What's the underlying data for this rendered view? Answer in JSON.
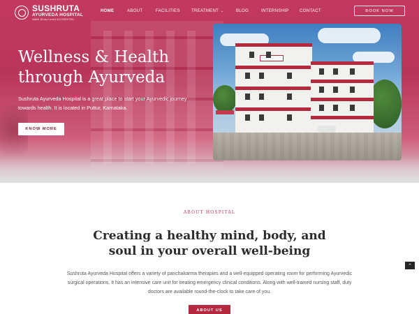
{
  "brand": {
    "name": "SUSHRUTA",
    "subtitle": "AYURVEDA HOSPITAL",
    "tagline": "NABH (Entry Level) ACCREDITED",
    "icon": "lotus-emblem-icon"
  },
  "nav": {
    "items": [
      {
        "label": "HOME",
        "active": true
      },
      {
        "label": "ABOUT",
        "active": false
      },
      {
        "label": "FACILITIES",
        "active": false
      },
      {
        "label": "TREATMENT",
        "active": false,
        "has_dropdown": true
      },
      {
        "label": "BLOG",
        "active": false
      },
      {
        "label": "INTERNSHIP",
        "active": false
      },
      {
        "label": "CONTACT",
        "active": false
      }
    ],
    "book_button": "BOOK NOW"
  },
  "hero": {
    "title_line1": "Wellness & Health",
    "title_line2": "through Ayurveda",
    "description": "Sushruta Ayurveda Hospital is a great place to start your Ayurvedic journey towards health. It is located in Puttur, Karnataka.",
    "button": "KNOW MORE",
    "photo_alt": "Sushruta Ayurveda Hospital building"
  },
  "about": {
    "kicker": "ABOUT HOSPITAL",
    "heading_line1": "Creating a healthy mind, body, and",
    "heading_line2": "soul in your overall well-being",
    "text": "Sushruta Ayurveda Hospital offers a variety of panchakarma therapies and a well-equipped operating room for performing Ayurvedic surgical operations. It has an intensive care unit for treating emergency clinical conditions. Along with well-trained nursing staff, duty doctors are available round-the-clock to take care of you.",
    "button": "ABOUT US"
  },
  "scroll_top_icon": "chevron-up-icon",
  "colors": {
    "primary": "#b5283f",
    "hero_overlay": "#c23a5e",
    "heading": "#2b2b2b",
    "body_text": "#555555"
  }
}
